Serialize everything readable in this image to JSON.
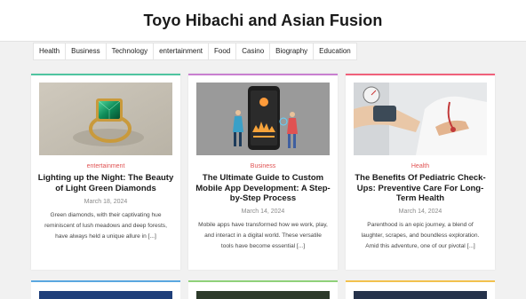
{
  "site": {
    "title": "Toyo Hibachi and Asian Fusion"
  },
  "nav": {
    "items": [
      "Health",
      "Business",
      "Technology",
      "entertainment",
      "Food",
      "Casino",
      "Biography",
      "Education"
    ]
  },
  "posts": [
    {
      "category": "entertainment",
      "title": "Lighting up the Night: The Beauty of Light Green Diamonds",
      "date": "March 18, 2024",
      "excerpt": "Green diamonds, with their captivating hue reminiscent of lush meadows and deep forests, have always held a unique allure in [...]",
      "accent": "#4fc4a0"
    },
    {
      "category": "Business",
      "title": "The Ultimate Guide to Custom Mobile App Development: A Step-by-Step Process",
      "date": "March 14, 2024",
      "excerpt": "Mobile apps have transformed how we work, play, and interact in a digital world. These versatile tools have become essential [...]",
      "accent": "#c97fd0"
    },
    {
      "category": "Health",
      "title": "The Benefits Of Pediatric Check-Ups: Preventive Care For Long-Term Health",
      "date": "March 14, 2024",
      "excerpt": "Parenthood is an epic journey, a blend of laughter, scrapes, and boundless exploration. Amid this adventure, one of our pivotal [...]",
      "accent": "#f0607a"
    }
  ],
  "next_row_accents": [
    "#5aa7e0",
    "#8fd17a",
    "#f2c14e"
  ],
  "colors": {
    "category": "#e05252",
    "background": "#f1f1f1"
  }
}
